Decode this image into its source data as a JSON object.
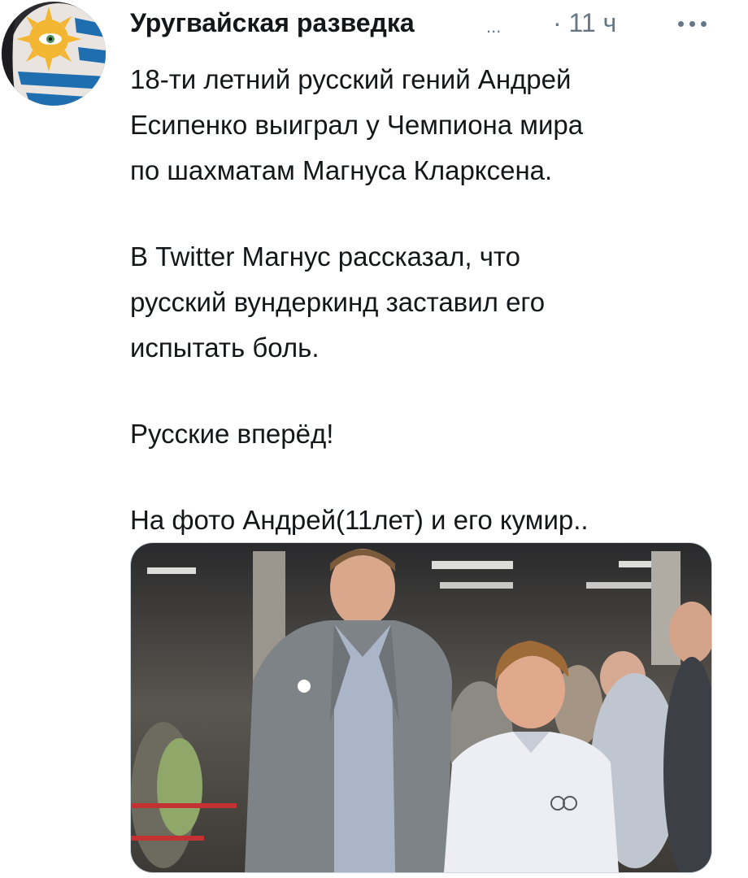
{
  "tweet": {
    "author": {
      "display_name": "Уругвайская разведка",
      "name_truncation": "...",
      "avatar_icon": "uruguay-flag-face-avatar"
    },
    "time_separator": "·",
    "timestamp": "11 ч",
    "more_icon": "more-dots-icon",
    "text_lines": [
      "18-ти летний русский гений Андрей",
      "Есипенко выиграл у Чемпиона мира",
      "по шахматам Магнуса Кларксена.",
      "В Twitter Магнус рассказал, что",
      "русский вундеркинд заставил его",
      "испытать боль.",
      "Русские вперёд!",
      "На фото Андрей(11лет) и его кумир.."
    ],
    "media": {
      "description_icon": "photo-two-people-chess-event"
    }
  },
  "colors": {
    "text_primary": "#14171a",
    "text_secondary": "#657786",
    "background": "#ffffff",
    "border": "#ccd6dd"
  }
}
